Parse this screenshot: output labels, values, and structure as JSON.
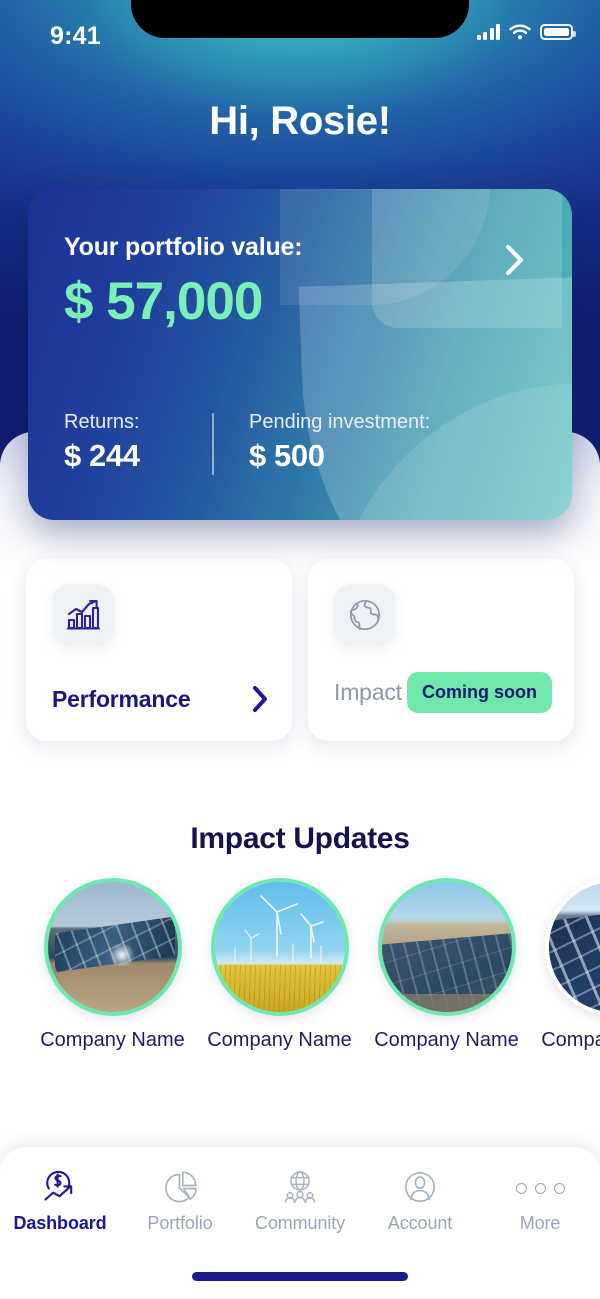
{
  "status_bar": {
    "time": "9:41",
    "signal_icon": "cellular-signal-icon",
    "wifi_icon": "wifi-icon",
    "battery_icon": "battery-icon"
  },
  "header": {
    "greeting": "Hi, Rosie!"
  },
  "portfolio_card": {
    "label": "Your portfolio value:",
    "value": "$ 57,000",
    "value_color": "#7af0b6",
    "chevron_icon": "chevron-right-icon",
    "stats": [
      {
        "key": "Returns:",
        "value": "$ 244"
      },
      {
        "key": "Pending investment:",
        "value": "$ 500"
      }
    ]
  },
  "feature_cards": [
    {
      "title": "Performance",
      "icon": "bar-chart-growth-icon",
      "chevron_icon": "chevron-right-icon",
      "badge": null,
      "disabled": false
    },
    {
      "title": "Impact",
      "icon": "globe-icon",
      "chevron_icon": null,
      "badge": "Coming soon",
      "badge_color": "#70e8ab",
      "disabled": true
    }
  ],
  "impact_updates": {
    "title": "Impact Updates",
    "ring_color": "#6fe8b0",
    "stories": [
      {
        "name": "Company\nName",
        "image": "solar-panel-field-photo"
      },
      {
        "name": "Company\nName",
        "image": "wind-turbine-field-photo"
      },
      {
        "name": "Company\nName",
        "image": "aerial-solar-farm-photo"
      },
      {
        "name": "Company\nName",
        "image": "solar-panel-closeup-photo"
      }
    ]
  },
  "bottom_nav": {
    "active": "Dashboard",
    "items": [
      {
        "label": "Dashboard",
        "icon": "dollar-growth-icon",
        "active": true
      },
      {
        "label": "Portfolio",
        "icon": "pie-chart-icon",
        "active": false
      },
      {
        "label": "Community",
        "icon": "globe-people-icon",
        "active": false
      },
      {
        "label": "Account",
        "icon": "user-circle-icon",
        "active": false
      },
      {
        "label": "More",
        "icon": "three-dots-icon",
        "active": false
      }
    ]
  }
}
